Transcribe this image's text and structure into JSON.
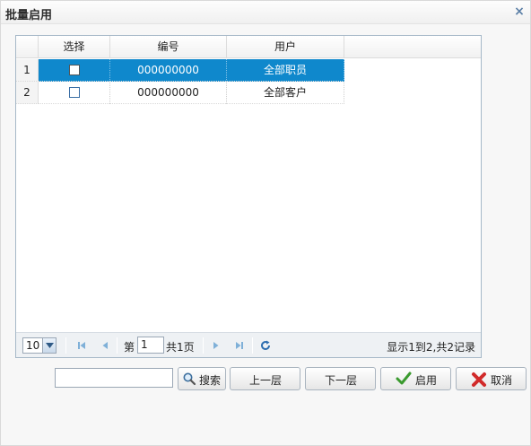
{
  "dialog": {
    "title": "批量启用",
    "close_symbol": "×"
  },
  "grid": {
    "columns": [
      "选择",
      "编号",
      "用户"
    ],
    "rows": [
      {
        "num": "1",
        "code": "000000000",
        "user": "全部职员",
        "checked": false,
        "selected": true
      },
      {
        "num": "2",
        "code": "000000000",
        "user": "全部客户",
        "checked": false,
        "selected": false
      }
    ]
  },
  "pager": {
    "page_size": "10",
    "page_prefix": "第",
    "page_value": "1",
    "page_total": "共1页",
    "info": "显示1到2,共2记录"
  },
  "actions": {
    "search_value": "",
    "search_label": "搜索",
    "up_label": "上一层",
    "down_label": "下一层",
    "enable_label": "启用",
    "cancel_label": "取消"
  },
  "colors": {
    "selected_row": "#0f88cc",
    "grid_border": "#a6b8c8",
    "icon_blue": "#5b7fa6"
  },
  "icons": [
    "close-icon",
    "first-page-icon",
    "prev-page-icon",
    "next-page-icon",
    "last-page-icon",
    "refresh-icon",
    "search-icon",
    "check-icon",
    "cancel-x-icon",
    "dropdown-arrow-icon"
  ]
}
